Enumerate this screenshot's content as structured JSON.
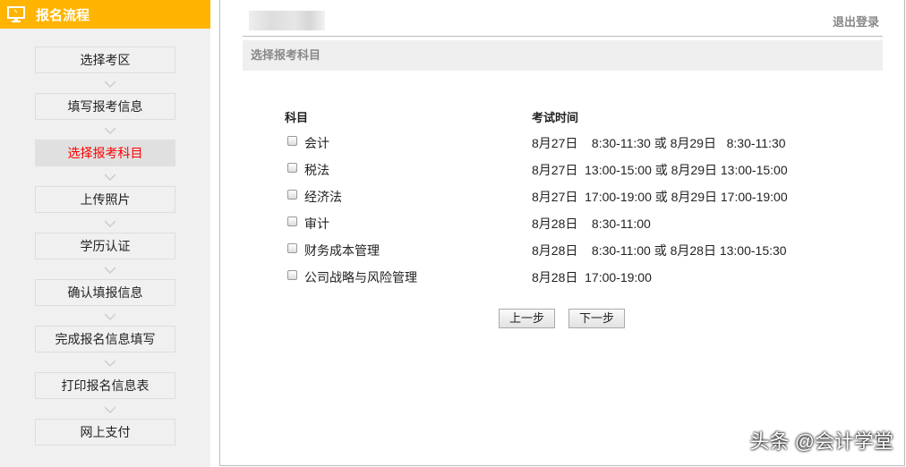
{
  "sidebar": {
    "title": "报名流程",
    "steps": [
      "选择考区",
      "填写报考信息",
      "选择报考科目",
      "上传照片",
      "学历认证",
      "确认填报信息",
      "完成报名信息填写",
      "打印报名信息表",
      "网上支付"
    ],
    "active_index": 2
  },
  "header": {
    "logout": "退出登录"
  },
  "section": {
    "title": "选择报考科目"
  },
  "table": {
    "headers": [
      "科目",
      "考试时间"
    ],
    "rows": [
      {
        "subject": "会计",
        "time": "8月27日    8:30-11:30 或 8月29日   8:30-11:30",
        "checked": false
      },
      {
        "subject": "税法",
        "time": "8月27日  13:00-15:00 或 8月29日 13:00-15:00",
        "checked": false
      },
      {
        "subject": "经济法",
        "time": "8月27日  17:00-19:00 或 8月29日 17:00-19:00",
        "checked": false
      },
      {
        "subject": "审计",
        "time": "8月28日    8:30-11:00",
        "checked": false
      },
      {
        "subject": "财务成本管理",
        "time": "8月28日    8:30-11:00 或 8月28日 13:00-15:30",
        "checked": false
      },
      {
        "subject": "公司战略与风险管理",
        "time": "8月28日  17:00-19:00",
        "checked": false
      }
    ]
  },
  "buttons": {
    "prev": "上一步",
    "next": "下一步"
  },
  "watermark": "头条 @会计学堂",
  "colors": {
    "accent": "#ffb400",
    "active": "#ff0000"
  }
}
